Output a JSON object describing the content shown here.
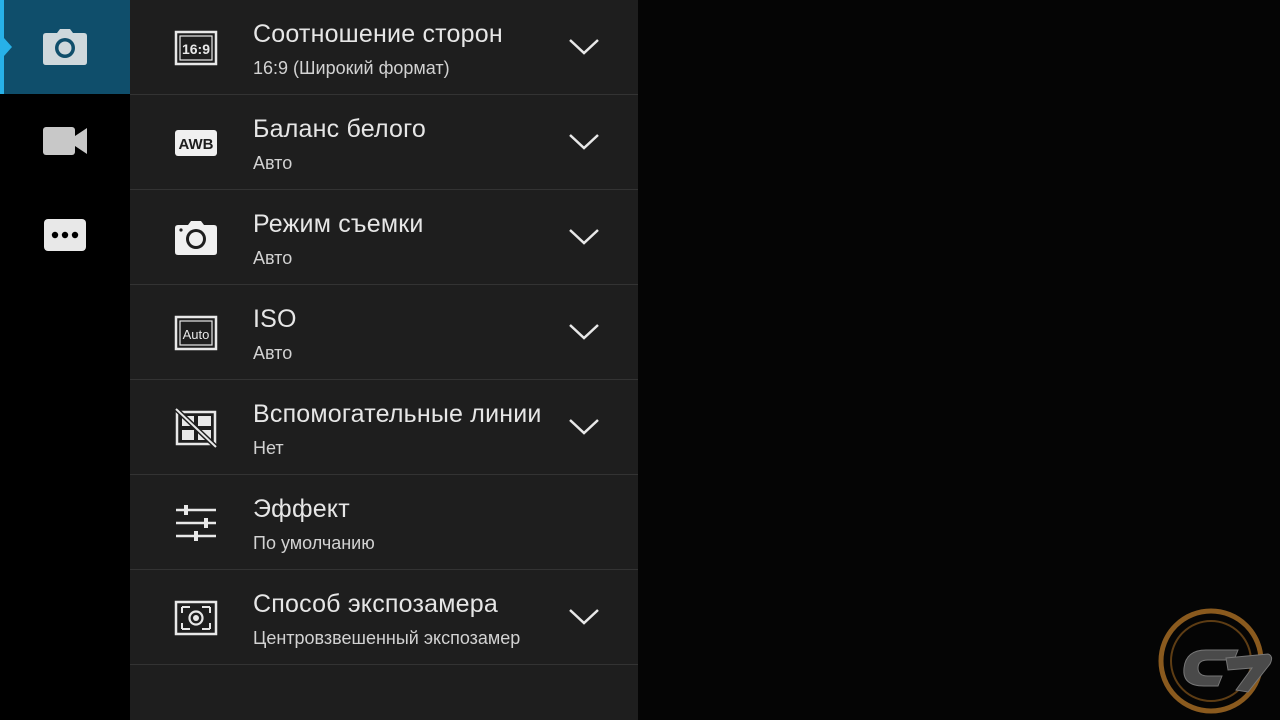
{
  "sidebar": {
    "tabs": [
      {
        "id": "photo",
        "icon": "camera-icon",
        "active": true
      },
      {
        "id": "video",
        "icon": "video-camera-icon",
        "active": false
      },
      {
        "id": "more",
        "icon": "more-icon",
        "active": false
      }
    ]
  },
  "settings": [
    {
      "icon": "aspect-ratio-icon",
      "title": "Соотношение сторон",
      "value": "16:9 (Широкий формат)",
      "has_dropdown": true
    },
    {
      "icon": "awb-icon",
      "title": "Баланс белого",
      "value": "Авто",
      "has_dropdown": true
    },
    {
      "icon": "camera-mode-icon",
      "title": "Режим съемки",
      "value": "Авто",
      "has_dropdown": true
    },
    {
      "icon": "iso-auto-icon",
      "title": "ISO",
      "value": "Авто",
      "has_dropdown": true
    },
    {
      "icon": "grid-lines-off-icon",
      "title": "Вспомогательные линии",
      "value": "Нет",
      "has_dropdown": true
    },
    {
      "icon": "effect-sliders-icon",
      "title": "Эффект",
      "value": "По умолчанию",
      "has_dropdown": false
    },
    {
      "icon": "metering-icon",
      "title": "Способ экспозамера",
      "value": "Центровзвешенный экспозамер",
      "has_dropdown": true
    }
  ],
  "icon_labels": {
    "aspect_ratio": "16:9",
    "awb": "AWB",
    "iso": "Auto"
  },
  "colors": {
    "accent": "#27b1e8",
    "active_tab_bg": "#0f4e6b",
    "panel_bg": "#1e1e1e",
    "divider": "#333333",
    "text_primary": "#e6e6e6",
    "text_secondary": "#d2d2d2",
    "watermark": "#8a5a1e"
  }
}
